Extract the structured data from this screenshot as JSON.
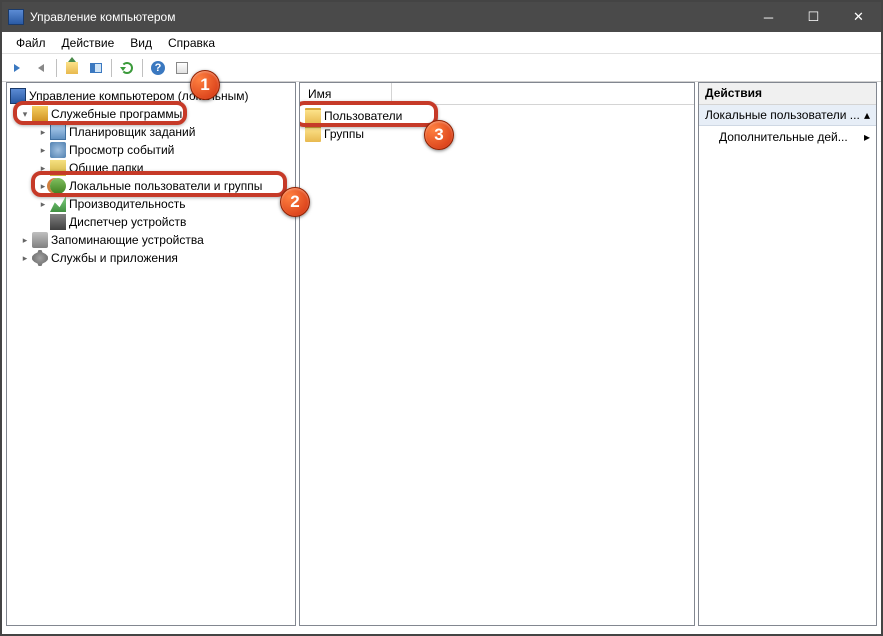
{
  "window": {
    "title": "Управление компьютером"
  },
  "menu": {
    "file": "Файл",
    "action": "Действие",
    "view": "Вид",
    "help": "Справка"
  },
  "tree": {
    "root": "Управление компьютером (локальным)",
    "tools": "Служебные программы",
    "scheduler": "Планировщик заданий",
    "events": "Просмотр событий",
    "shares": "Общие папки",
    "lusrmgr": "Локальные пользователи и группы",
    "perf": "Производительность",
    "devmgr": "Диспетчер устройств",
    "storage": "Запоминающие устройства",
    "services": "Службы и приложения"
  },
  "center": {
    "col_name": "Имя",
    "users": "Пользователи",
    "groups": "Группы"
  },
  "actions": {
    "header": "Действия",
    "subject": "Локальные пользователи ...",
    "more": "Дополнительные дей..."
  },
  "badges": {
    "b1": "1",
    "b2": "2",
    "b3": "3"
  }
}
